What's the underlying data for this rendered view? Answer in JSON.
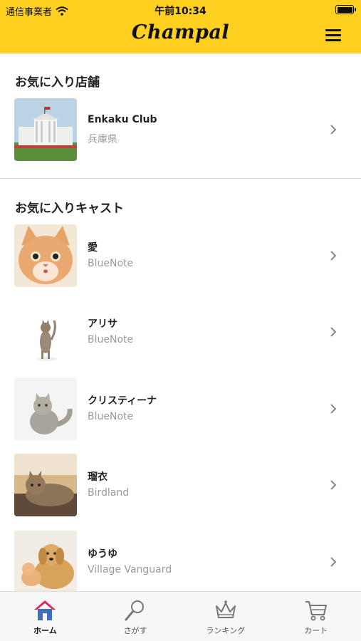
{
  "status_bar": {
    "carrier": "通信事業者",
    "time": "午前10:34"
  },
  "header": {
    "brand": "Champal"
  },
  "favorite_stores": {
    "title": "お気に入り店舗",
    "items": [
      {
        "name": "Enkaku Club",
        "sub": "兵庫県"
      }
    ]
  },
  "favorite_casts": {
    "title": "お気に入りキャスト",
    "items": [
      {
        "name": "愛",
        "sub": "BlueNote"
      },
      {
        "name": "アリサ",
        "sub": "BlueNote"
      },
      {
        "name": "クリスティーナ",
        "sub": "BlueNote"
      },
      {
        "name": "瑠衣",
        "sub": "Birdland"
      },
      {
        "name": "ゆうゆ",
        "sub": "Village Vanguard"
      }
    ]
  },
  "tabbar": {
    "items": [
      {
        "label": "ホーム",
        "icon": "home-icon",
        "active": true
      },
      {
        "label": "さがす",
        "icon": "search-icon",
        "active": false
      },
      {
        "label": "ランキング",
        "icon": "crown-icon",
        "active": false
      },
      {
        "label": "カート",
        "icon": "cart-icon",
        "active": false
      }
    ]
  },
  "colors": {
    "accent": "#FFD01F",
    "subtext": "#9a9a9a",
    "home_roof": "#e0245e"
  }
}
